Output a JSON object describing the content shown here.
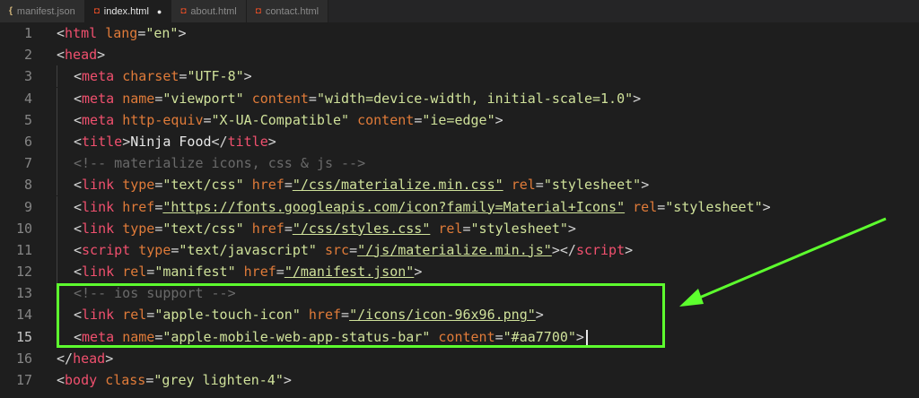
{
  "tabs": [
    {
      "label": "manifest.json",
      "icon": "json-file-icon",
      "active": false
    },
    {
      "label": "index.html",
      "icon": "html-file-icon",
      "active": true,
      "modified": true
    },
    {
      "label": "about.html",
      "icon": "html-file-icon",
      "active": false
    },
    {
      "label": "contact.html",
      "icon": "html-file-icon",
      "active": false
    }
  ],
  "lines": [
    {
      "n": "1",
      "tokens": [
        [
          "<",
          "punct"
        ],
        [
          "html",
          "tag"
        ],
        [
          " ",
          "punct"
        ],
        [
          "lang",
          "attr"
        ],
        [
          "=",
          "punct"
        ],
        [
          "\"en\"",
          "str"
        ],
        [
          ">",
          "punct"
        ]
      ]
    },
    {
      "n": "2",
      "tokens": [
        [
          "<",
          "punct"
        ],
        [
          "head",
          "tag"
        ],
        [
          ">",
          "punct"
        ]
      ]
    },
    {
      "n": "3",
      "tokens": [
        [
          "<",
          "punct"
        ],
        [
          "meta",
          "tag"
        ],
        [
          " ",
          "punct"
        ],
        [
          "charset",
          "attr"
        ],
        [
          "=",
          "punct"
        ],
        [
          "\"UTF-8\"",
          "str"
        ],
        [
          ">",
          "punct"
        ]
      ]
    },
    {
      "n": "4",
      "tokens": [
        [
          "<",
          "punct"
        ],
        [
          "meta",
          "tag"
        ],
        [
          " ",
          "punct"
        ],
        [
          "name",
          "attr"
        ],
        [
          "=",
          "punct"
        ],
        [
          "\"viewport\"",
          "str"
        ],
        [
          " ",
          "punct"
        ],
        [
          "content",
          "attr"
        ],
        [
          "=",
          "punct"
        ],
        [
          "\"width=device-width, initial-scale=1.0\"",
          "str"
        ],
        [
          ">",
          "punct"
        ]
      ]
    },
    {
      "n": "5",
      "tokens": [
        [
          "<",
          "punct"
        ],
        [
          "meta",
          "tag"
        ],
        [
          " ",
          "punct"
        ],
        [
          "http-equiv",
          "attr"
        ],
        [
          "=",
          "punct"
        ],
        [
          "\"X-UA-Compatible\"",
          "str"
        ],
        [
          " ",
          "punct"
        ],
        [
          "content",
          "attr"
        ],
        [
          "=",
          "punct"
        ],
        [
          "\"ie=edge\"",
          "str"
        ],
        [
          ">",
          "punct"
        ]
      ]
    },
    {
      "n": "6",
      "tokens": [
        [
          "<",
          "punct"
        ],
        [
          "title",
          "tag"
        ],
        [
          ">",
          "punct"
        ],
        [
          "Ninja Food",
          "text"
        ],
        [
          "</",
          "punct"
        ],
        [
          "title",
          "tag"
        ],
        [
          ">",
          "punct"
        ]
      ]
    },
    {
      "n": "7",
      "tokens": [
        [
          "<!-- materialize icons, css & js -->",
          "comment"
        ]
      ]
    },
    {
      "n": "8",
      "tokens": [
        [
          "<",
          "punct"
        ],
        [
          "link",
          "tag"
        ],
        [
          " ",
          "punct"
        ],
        [
          "type",
          "attr"
        ],
        [
          "=",
          "punct"
        ],
        [
          "\"text/css\"",
          "str"
        ],
        [
          " ",
          "punct"
        ],
        [
          "href",
          "attr"
        ],
        [
          "=",
          "punct"
        ],
        [
          "\"/css/materialize.min.css\"",
          "str-u"
        ],
        [
          " ",
          "punct"
        ],
        [
          "rel",
          "attr"
        ],
        [
          "=",
          "punct"
        ],
        [
          "\"stylesheet\"",
          "str"
        ],
        [
          ">",
          "punct"
        ]
      ]
    },
    {
      "n": "9",
      "tokens": [
        [
          "<",
          "punct"
        ],
        [
          "link",
          "tag"
        ],
        [
          " ",
          "punct"
        ],
        [
          "href",
          "attr"
        ],
        [
          "=",
          "punct"
        ],
        [
          "\"https://fonts.googleapis.com/icon?family=Material+Icons\"",
          "str-u"
        ],
        [
          " ",
          "punct"
        ],
        [
          "rel",
          "attr"
        ],
        [
          "=",
          "punct"
        ],
        [
          "\"stylesheet\"",
          "str"
        ],
        [
          ">",
          "punct"
        ]
      ]
    },
    {
      "n": "10",
      "tokens": [
        [
          "<",
          "punct"
        ],
        [
          "link",
          "tag"
        ],
        [
          " ",
          "punct"
        ],
        [
          "type",
          "attr"
        ],
        [
          "=",
          "punct"
        ],
        [
          "\"text/css\"",
          "str"
        ],
        [
          " ",
          "punct"
        ],
        [
          "href",
          "attr"
        ],
        [
          "=",
          "punct"
        ],
        [
          "\"/css/styles.css\"",
          "str-u"
        ],
        [
          " ",
          "punct"
        ],
        [
          "rel",
          "attr"
        ],
        [
          "=",
          "punct"
        ],
        [
          "\"stylesheet\"",
          "str"
        ],
        [
          ">",
          "punct"
        ]
      ]
    },
    {
      "n": "11",
      "tokens": [
        [
          "<",
          "punct"
        ],
        [
          "script",
          "tag"
        ],
        [
          " ",
          "punct"
        ],
        [
          "type",
          "attr"
        ],
        [
          "=",
          "punct"
        ],
        [
          "\"text/javascript\"",
          "str"
        ],
        [
          " ",
          "punct"
        ],
        [
          "src",
          "attr"
        ],
        [
          "=",
          "punct"
        ],
        [
          "\"/js/materialize.min.js\"",
          "str-u"
        ],
        [
          "></",
          "punct"
        ],
        [
          "script",
          "tag"
        ],
        [
          ">",
          "punct"
        ]
      ]
    },
    {
      "n": "12",
      "tokens": [
        [
          "<",
          "punct"
        ],
        [
          "link",
          "tag"
        ],
        [
          " ",
          "punct"
        ],
        [
          "rel",
          "attr"
        ],
        [
          "=",
          "punct"
        ],
        [
          "\"manifest\"",
          "str"
        ],
        [
          " ",
          "punct"
        ],
        [
          "href",
          "attr"
        ],
        [
          "=",
          "punct"
        ],
        [
          "\"/manifest.json\"",
          "str-u"
        ],
        [
          ">",
          "punct"
        ]
      ]
    },
    {
      "n": "13",
      "tokens": [
        [
          "<!-- ios support -->",
          "comment"
        ]
      ]
    },
    {
      "n": "14",
      "tokens": [
        [
          "<",
          "punct"
        ],
        [
          "link",
          "tag"
        ],
        [
          " ",
          "punct"
        ],
        [
          "rel",
          "attr"
        ],
        [
          "=",
          "punct"
        ],
        [
          "\"apple-touch-icon\"",
          "str"
        ],
        [
          " ",
          "punct"
        ],
        [
          "href",
          "attr"
        ],
        [
          "=",
          "punct"
        ],
        [
          "\"/icons/icon-96x96.png\"",
          "str-u"
        ],
        [
          ">",
          "punct"
        ]
      ]
    },
    {
      "n": "15",
      "current": true,
      "tokens": [
        [
          "<",
          "punct"
        ],
        [
          "meta",
          "tag"
        ],
        [
          " ",
          "punct"
        ],
        [
          "name",
          "attr"
        ],
        [
          "=",
          "punct"
        ],
        [
          "\"apple-mobile-web-app-status-bar\"",
          "str"
        ],
        [
          " ",
          "punct"
        ],
        [
          "content",
          "attr"
        ],
        [
          "=",
          "punct"
        ],
        [
          "\"#aa7700\"",
          "str"
        ],
        [
          ">",
          "punct"
        ]
      ]
    },
    {
      "n": "16",
      "tokens": [
        [
          "</",
          "punct"
        ],
        [
          "head",
          "tag"
        ],
        [
          ">",
          "punct"
        ]
      ]
    },
    {
      "n": "17",
      "tokens": [
        [
          "<",
          "punct"
        ],
        [
          "body",
          "tag"
        ],
        [
          " ",
          "punct"
        ],
        [
          "class",
          "attr"
        ],
        [
          "=",
          "punct"
        ],
        [
          "\"grey lighten-4\"",
          "str"
        ],
        [
          ">",
          "punct"
        ]
      ]
    }
  ],
  "colors": {
    "highlight_box": "#5dff2e",
    "arrow": "#5dff2e"
  }
}
